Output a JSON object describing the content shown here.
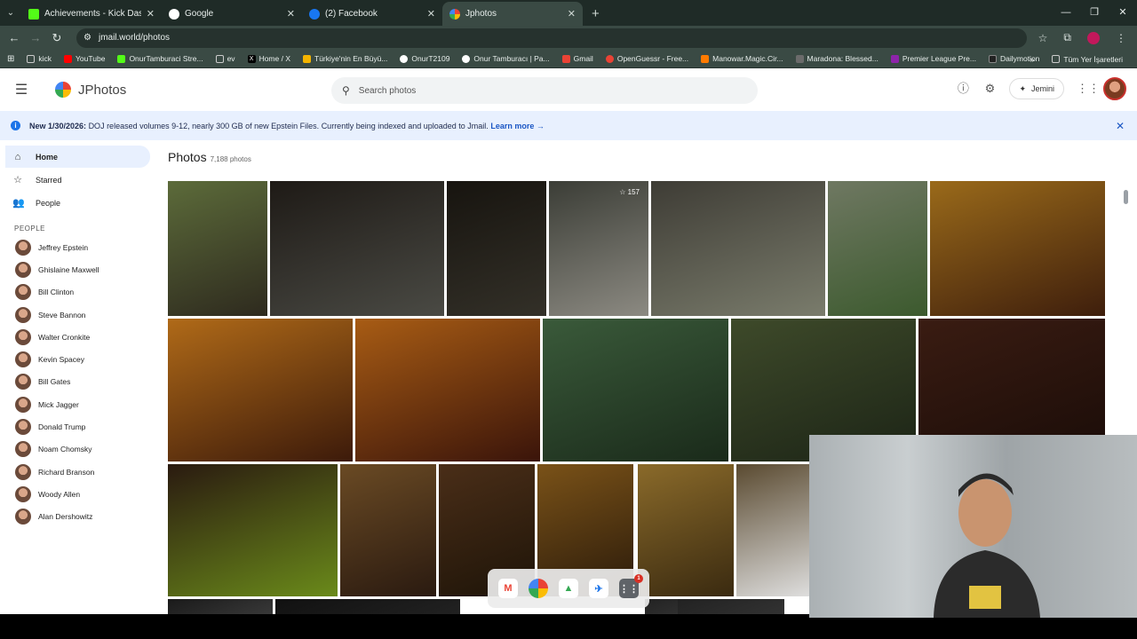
{
  "browser": {
    "tabs": [
      {
        "title": "Achievements - Kick Dashboard",
        "color": "#53fc18"
      },
      {
        "title": "Google",
        "color": "#4285f4"
      },
      {
        "title": "(2) Facebook",
        "color": "#1877f2"
      },
      {
        "title": "Jphotos",
        "color": "#fbbc05"
      }
    ],
    "url": "jmail.world/photos",
    "bookmarks": [
      {
        "label": "kick",
        "color": "#6b6b6b"
      },
      {
        "label": "YouTube",
        "color": "#ff0000"
      },
      {
        "label": "OnurTamburaci Stre...",
        "color": "#53fc18"
      },
      {
        "label": "ev",
        "color": "#6b6b6b"
      },
      {
        "label": "Home / X",
        "color": "#000000"
      },
      {
        "label": "Türkiye'nin En Büyü...",
        "color": "#f4b400"
      },
      {
        "label": "OnurT2109",
        "color": "#ffffff"
      },
      {
        "label": "Onur Tamburacı | Pa...",
        "color": "#ffffff"
      },
      {
        "label": "Gmail",
        "color": "#ea4335"
      },
      {
        "label": "OpenGuessr - Free...",
        "color": "#ea4335"
      },
      {
        "label": "Manowar.Magic.Cir...",
        "color": "#ff7a00"
      },
      {
        "label": "Maradona: Blessed...",
        "color": "#6b6b6b"
      },
      {
        "label": "Premier League Pre...",
        "color": "#8e24aa"
      },
      {
        "label": "Dailymotion",
        "color": "#222222"
      }
    ],
    "bookmarks_all": "Tüm Yer İşaretleri"
  },
  "app": {
    "name": "JPhotos",
    "search_placeholder": "Search photos",
    "gemini_label": "Jemini"
  },
  "banner": {
    "bold": "New 1/30/2026:",
    "text": "DOJ released volumes 9-12, nearly 300 GB of new Epstein Files. Currently being indexed and uploaded to Jmail.",
    "link": "Learn more →"
  },
  "sidebar": {
    "items": [
      {
        "label": "Home",
        "icon": "home-icon"
      },
      {
        "label": "Starred",
        "icon": "star-icon"
      },
      {
        "label": "People",
        "icon": "people-icon"
      }
    ],
    "people_heading": "PEOPLE",
    "people": [
      "Jeffrey Epstein",
      "Ghislaine Maxwell",
      "Bill Clinton",
      "Steve Bannon",
      "Walter Cronkite",
      "Kevin Spacey",
      "Bill Gates",
      "Mick Jagger",
      "Donald Trump",
      "Noam Chomsky",
      "Richard Branson",
      "Woody Allen",
      "Alan Dershowitz"
    ]
  },
  "main": {
    "title": "Photos",
    "count": "7,188 photos",
    "starred_count": "157"
  },
  "dock": {
    "badge": "1"
  }
}
